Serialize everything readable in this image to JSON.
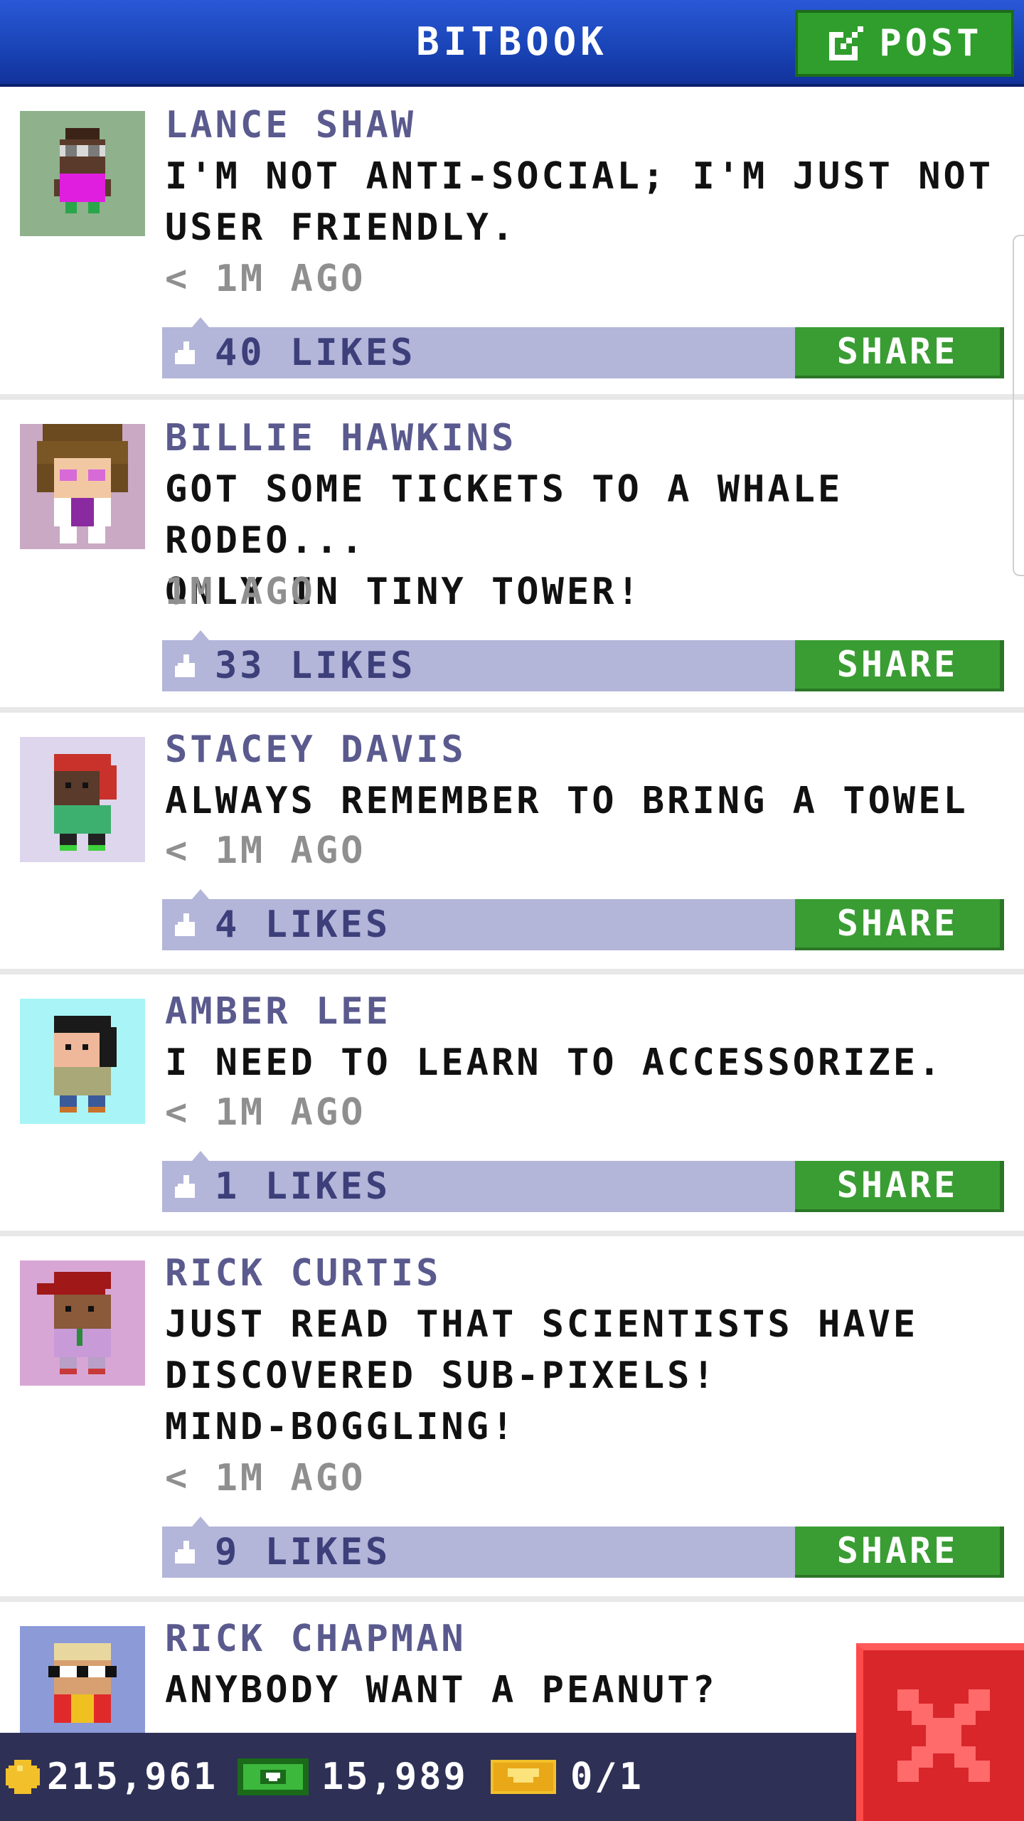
{
  "header": {
    "title": "BITBOOK",
    "post_label": "POST"
  },
  "posts": [
    {
      "author": "LANCE SHAW",
      "message": "I'M NOT ANTI-SOCIAL; I'M JUST NOT\nUSER FRIENDLY.",
      "time": "< 1M AGO",
      "likes": "40 LIKES",
      "share": "SHARE",
      "avatar_bg": "#8fb18c"
    },
    {
      "author": "BILLIE HAWKINS",
      "message": "GOT SOME TICKETS TO A WHALE RODEO...\nONLY IN TINY TOWER!",
      "time": "1M AGO",
      "likes": "33 LIKES",
      "share": "SHARE",
      "avatar_bg": "#c9a9c4"
    },
    {
      "author": "STACEY DAVIS",
      "message": "ALWAYS REMEMBER TO BRING A TOWEL",
      "time": "< 1M AGO",
      "likes": "4 LIKES",
      "share": "SHARE",
      "avatar_bg": "#ddd6ec"
    },
    {
      "author": "AMBER LEE",
      "message": "I NEED TO LEARN TO ACCESSORIZE.",
      "time": "< 1M AGO",
      "likes": "1 LIKES",
      "share": "SHARE",
      "avatar_bg": "#a8f4f6"
    },
    {
      "author": "RICK CURTIS",
      "message": "JUST READ THAT SCIENTISTS HAVE\nDISCOVERED SUB-PIXELS!\nMIND-BOGGLING!",
      "time": "< 1M AGO",
      "likes": "9 LIKES",
      "share": "SHARE",
      "avatar_bg": "#d8a6d4"
    },
    {
      "author": "RICK CHAPMAN",
      "message": "ANYBODY WANT A PEANUT?",
      "avatar_bg": "#8c9ad8"
    }
  ],
  "status": {
    "coins": "215,961",
    "bux": "15,989",
    "tickets": "0/1"
  },
  "colors": {
    "header_blue": "#1a45b8",
    "share_green": "#3a9d33",
    "likes_bar": "#b3b5d9",
    "author_text": "#5a5a8e",
    "close_red": "#d9262a"
  },
  "icons": {
    "post": "edit-icon",
    "likes": "thumbs-up-icon",
    "coin": "coin-icon",
    "bux": "bux-icon",
    "ticket": "ticket-icon",
    "close": "close-icon"
  }
}
